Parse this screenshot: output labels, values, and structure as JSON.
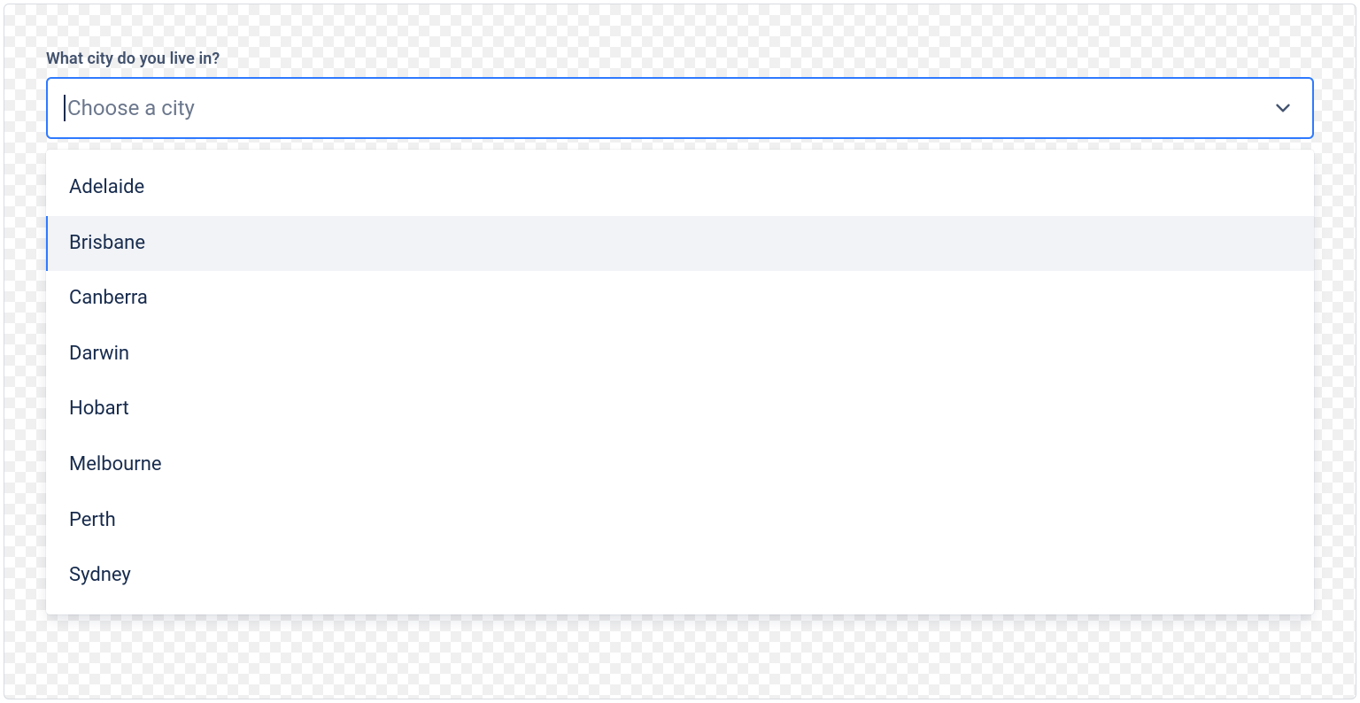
{
  "field": {
    "label": "What city do you live in?",
    "placeholder": "Choose a city"
  },
  "options": [
    {
      "label": "Adelaide",
      "highlighted": false
    },
    {
      "label": "Brisbane",
      "highlighted": true
    },
    {
      "label": "Canberra",
      "highlighted": false
    },
    {
      "label": "Darwin",
      "highlighted": false
    },
    {
      "label": "Hobart",
      "highlighted": false
    },
    {
      "label": "Melbourne",
      "highlighted": false
    },
    {
      "label": "Perth",
      "highlighted": false
    },
    {
      "label": "Sydney",
      "highlighted": false
    }
  ],
  "colors": {
    "focus": "#2f7aff",
    "text": "#172b4d",
    "muted": "#6b778c"
  }
}
